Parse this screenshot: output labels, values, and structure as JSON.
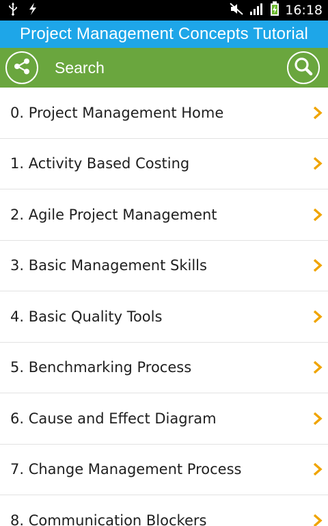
{
  "status_bar": {
    "time": "16:18",
    "icons": [
      "usb-icon",
      "flash-icon",
      "mute-icon",
      "signal-icon",
      "battery-icon"
    ]
  },
  "app": {
    "title": "Project Management Concepts Tutorial"
  },
  "action_bar": {
    "search_label": "Search",
    "icons": [
      "share-icon",
      "search-icon"
    ]
  },
  "list": {
    "items": [
      {
        "label": "0. Project Management Home"
      },
      {
        "label": "1. Activity Based Costing"
      },
      {
        "label": "2. Agile Project Management"
      },
      {
        "label": "3. Basic Management Skills"
      },
      {
        "label": "4. Basic Quality Tools"
      },
      {
        "label": "5. Benchmarking Process"
      },
      {
        "label": "6. Cause and Effect Diagram"
      },
      {
        "label": "7. Change Management Process"
      },
      {
        "label": "8. Communication Blockers"
      }
    ]
  },
  "colors": {
    "title_bar": "#1ea6e8",
    "action_bar": "#6aa63e",
    "chevron": "#f0a400",
    "status_bar": "#000000"
  }
}
